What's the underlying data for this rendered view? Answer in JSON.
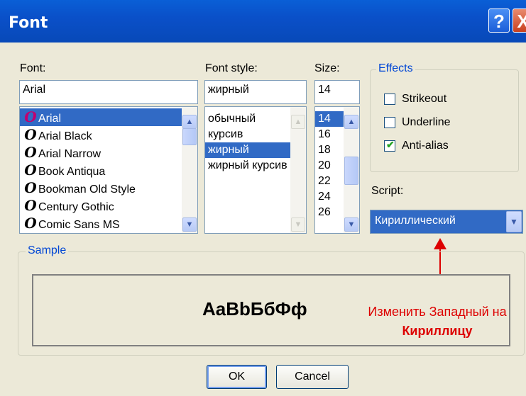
{
  "window": {
    "title": "Font",
    "help_symbol": "?",
    "close_symbol": "X"
  },
  "font": {
    "label": "Font:",
    "value": "Arial",
    "items": [
      "Arial",
      "Arial Black",
      "Arial Narrow",
      "Book Antiqua",
      "Bookman Old Style",
      "Century Gothic",
      "Comic Sans MS"
    ],
    "selected": "Arial",
    "icon_glyph": "O"
  },
  "style": {
    "label": "Font style:",
    "value": "жирный",
    "items": [
      "обычный",
      "курсив",
      "жирный",
      "жирный курсив"
    ],
    "selected": "жирный"
  },
  "size": {
    "label": "Size:",
    "value": "14",
    "items": [
      "14",
      "16",
      "18",
      "20",
      "22",
      "24",
      "26"
    ],
    "selected": "14"
  },
  "effects": {
    "label": "Effects",
    "strikeout": {
      "label": "Strikeout",
      "checked": false
    },
    "underline": {
      "label": "Underline",
      "checked": false
    },
    "antialias": {
      "label": "Anti-alias",
      "checked": true
    },
    "check_glyph": "✔"
  },
  "script": {
    "label": "Script:",
    "value": "Кириллический"
  },
  "sample": {
    "label": "Sample",
    "text": "AaBbБбФф"
  },
  "annotation": {
    "line1": "Изменить Западный на",
    "line2": "Кириллицу",
    "color": "#dd0000"
  },
  "buttons": {
    "ok": "OK",
    "cancel": "Cancel"
  },
  "colors": {
    "titlebar": "#0a50c9",
    "selection": "#316ac5",
    "dialog_bg": "#ece9d8"
  }
}
